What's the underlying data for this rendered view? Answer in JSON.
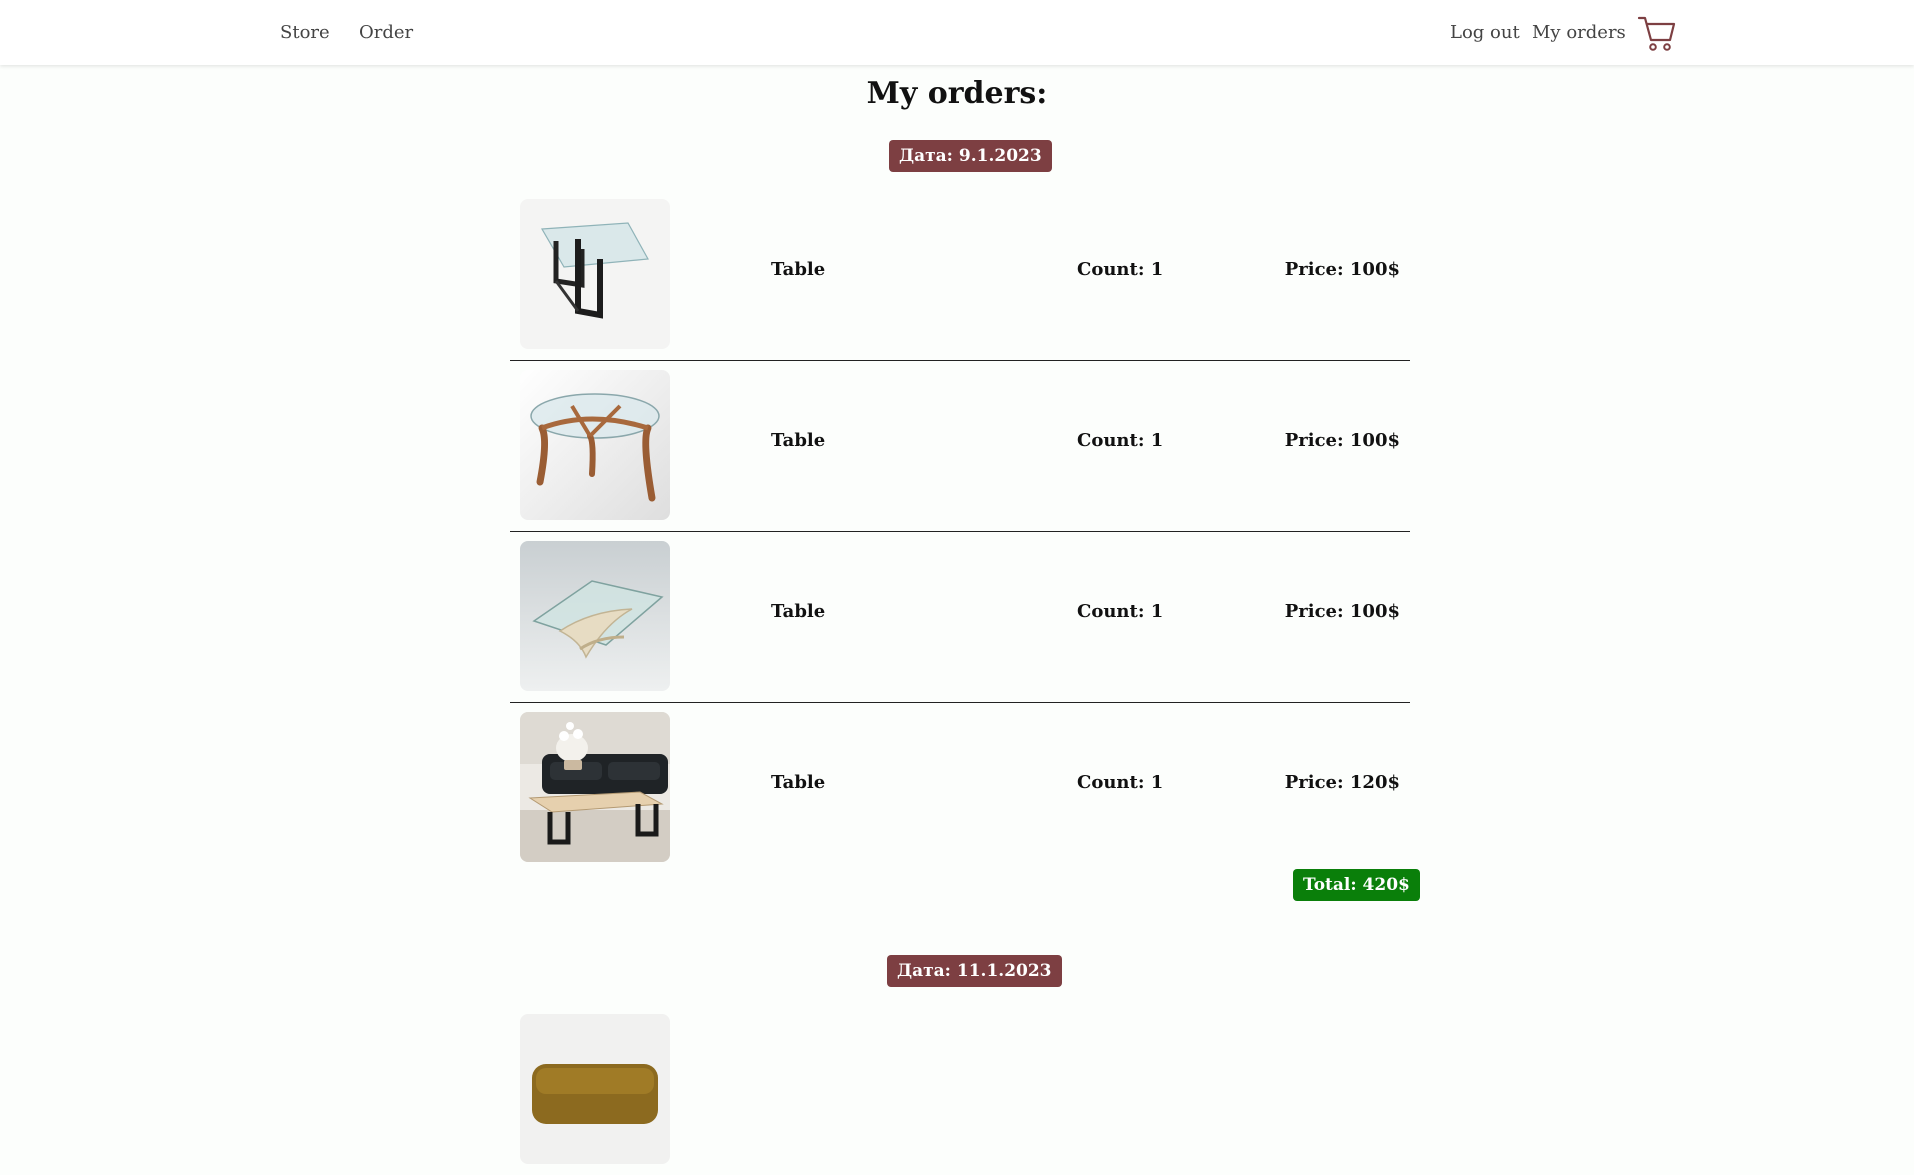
{
  "nav": {
    "left_links": [
      "Store",
      "Order"
    ],
    "logout": "Log out",
    "my_orders": "My orders",
    "cart_icon": "shopping-cart-icon"
  },
  "page": {
    "title": "My orders:"
  },
  "colors": {
    "date_badge": "#7d3f42",
    "total_badge": "#0a7f0a",
    "background": "#fcfefc"
  },
  "orders": [
    {
      "date": "Дата: 9.1.2023",
      "items": [
        {
          "name": "Table",
          "count": "Count: 1",
          "price": "Price: 100$",
          "image": "glass-table-black-legs"
        },
        {
          "name": "Table",
          "count": "Count: 1",
          "price": "Price: 100$",
          "image": "round-glass-table-wood-legs"
        },
        {
          "name": "Table",
          "count": "Count: 1",
          "price": "Price: 100$",
          "image": "glass-table-sculptural-base"
        },
        {
          "name": "Table",
          "count": "Count: 1",
          "price": "Price: 120$",
          "image": "coffee-table-living-room"
        }
      ],
      "total": "Total: 420$"
    },
    {
      "date": "Дата: 11.1.2023",
      "items": [
        {
          "image": "ochre-chair-partial"
        }
      ]
    }
  ]
}
